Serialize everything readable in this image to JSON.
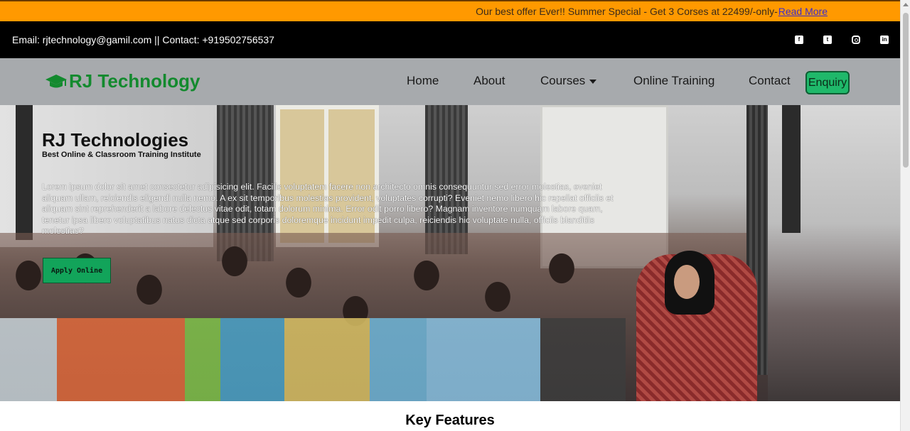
{
  "offer": {
    "text": "Our best offer Ever!! Summer Special - Get 3 Corses at 22499/-only-",
    "link": "Read More"
  },
  "contact": {
    "text": "Email: rjtechnology@gamil.com || Contact: +919502756537"
  },
  "social": {
    "icons": [
      "facebook-icon",
      "twitter-icon",
      "instagram-icon",
      "linkedin-icon"
    ]
  },
  "nav": {
    "brand": "RJ Technology",
    "brand_icon": "graduation-cap-icon",
    "items": [
      {
        "label": "Home"
      },
      {
        "label": "About"
      },
      {
        "label": "Courses"
      },
      {
        "label": "Online Training"
      },
      {
        "label": "Contact"
      }
    ],
    "enquiry": "Enquiry"
  },
  "hero": {
    "title": "RJ Technologies",
    "subtitle": "Best Online & Classroom Training Institute",
    "body": "Lorem ipsum dolor sit amet consectetur adipisicing elit. Facilis voluptatem facere non architecto omnis consequuntur sed error molestias, eveniet aliquam ullam, reiciendis eligendi nulla nemo. A ex sit temporibus molestias provident, voluptates corrupti? Eveniet nemo libero hic repellat officiis et aliquam sint reprehenderit a labore delectus vitae odit, totam dolorum minima. Error odit porro libero? Magnam inventore numquam labore quam, tenetur ipsa libero voluptatibus natus dicta atque sed corporis doloremque incidunt impedit culpa, reiciendis hic voluptate nulla, officiis blanditiis molestias?",
    "apply_button": "Apply Online"
  },
  "features": {
    "title": "Key Features"
  },
  "colors": {
    "offer_bar": "#ff9900",
    "brand_green": "#138a2e",
    "nav_bg": "#a7aaad",
    "enquiry_bg": "#1fb86a",
    "apply_bg": "#12a45a"
  }
}
